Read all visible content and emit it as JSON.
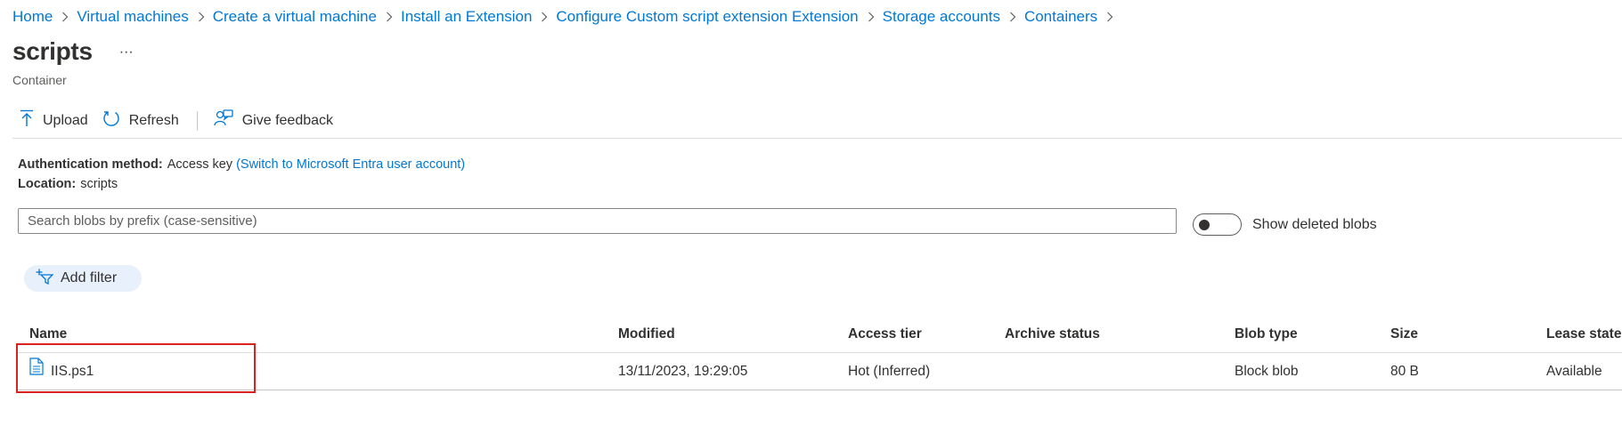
{
  "breadcrumb": [
    "Home",
    "Virtual machines",
    "Create a virtual machine",
    "Install an Extension",
    "Configure Custom script extension Extension",
    "Storage accounts",
    "Containers"
  ],
  "header": {
    "title": "scripts",
    "more_label": "···",
    "subtitle": "Container"
  },
  "toolbar": {
    "upload_label": "Upload",
    "refresh_label": "Refresh",
    "feedback_label": "Give feedback"
  },
  "info": {
    "auth_label": "Authentication method:",
    "auth_value": "Access key",
    "auth_switch": "(Switch to Microsoft Entra user account)",
    "location_label": "Location:",
    "location_value": "scripts"
  },
  "search": {
    "placeholder": "Search blobs by prefix (case-sensitive)",
    "value": ""
  },
  "toggle": {
    "label": "Show deleted blobs",
    "on": false
  },
  "filter": {
    "label": "Add filter"
  },
  "table": {
    "columns": [
      "Name",
      "Modified",
      "Access tier",
      "Archive status",
      "Blob type",
      "Size",
      "Lease state"
    ],
    "rows": [
      {
        "name": "IIS.ps1",
        "modified": "13/11/2023, 19:29:05",
        "access_tier": "Hot (Inferred)",
        "archive_status": "",
        "blob_type": "Block blob",
        "size": "80 B",
        "lease_state": "Available"
      }
    ]
  },
  "colors": {
    "link": "#0078d4",
    "text": "#323130",
    "highlight": "#d9221e",
    "pill_bg": "#e8f0fb"
  },
  "icons": {
    "upload": "upload-arrow-icon",
    "refresh": "refresh-icon",
    "feedback": "feedback-icon",
    "filter": "add-filter-icon",
    "file": "file-icon",
    "more": "ellipsis-icon"
  }
}
